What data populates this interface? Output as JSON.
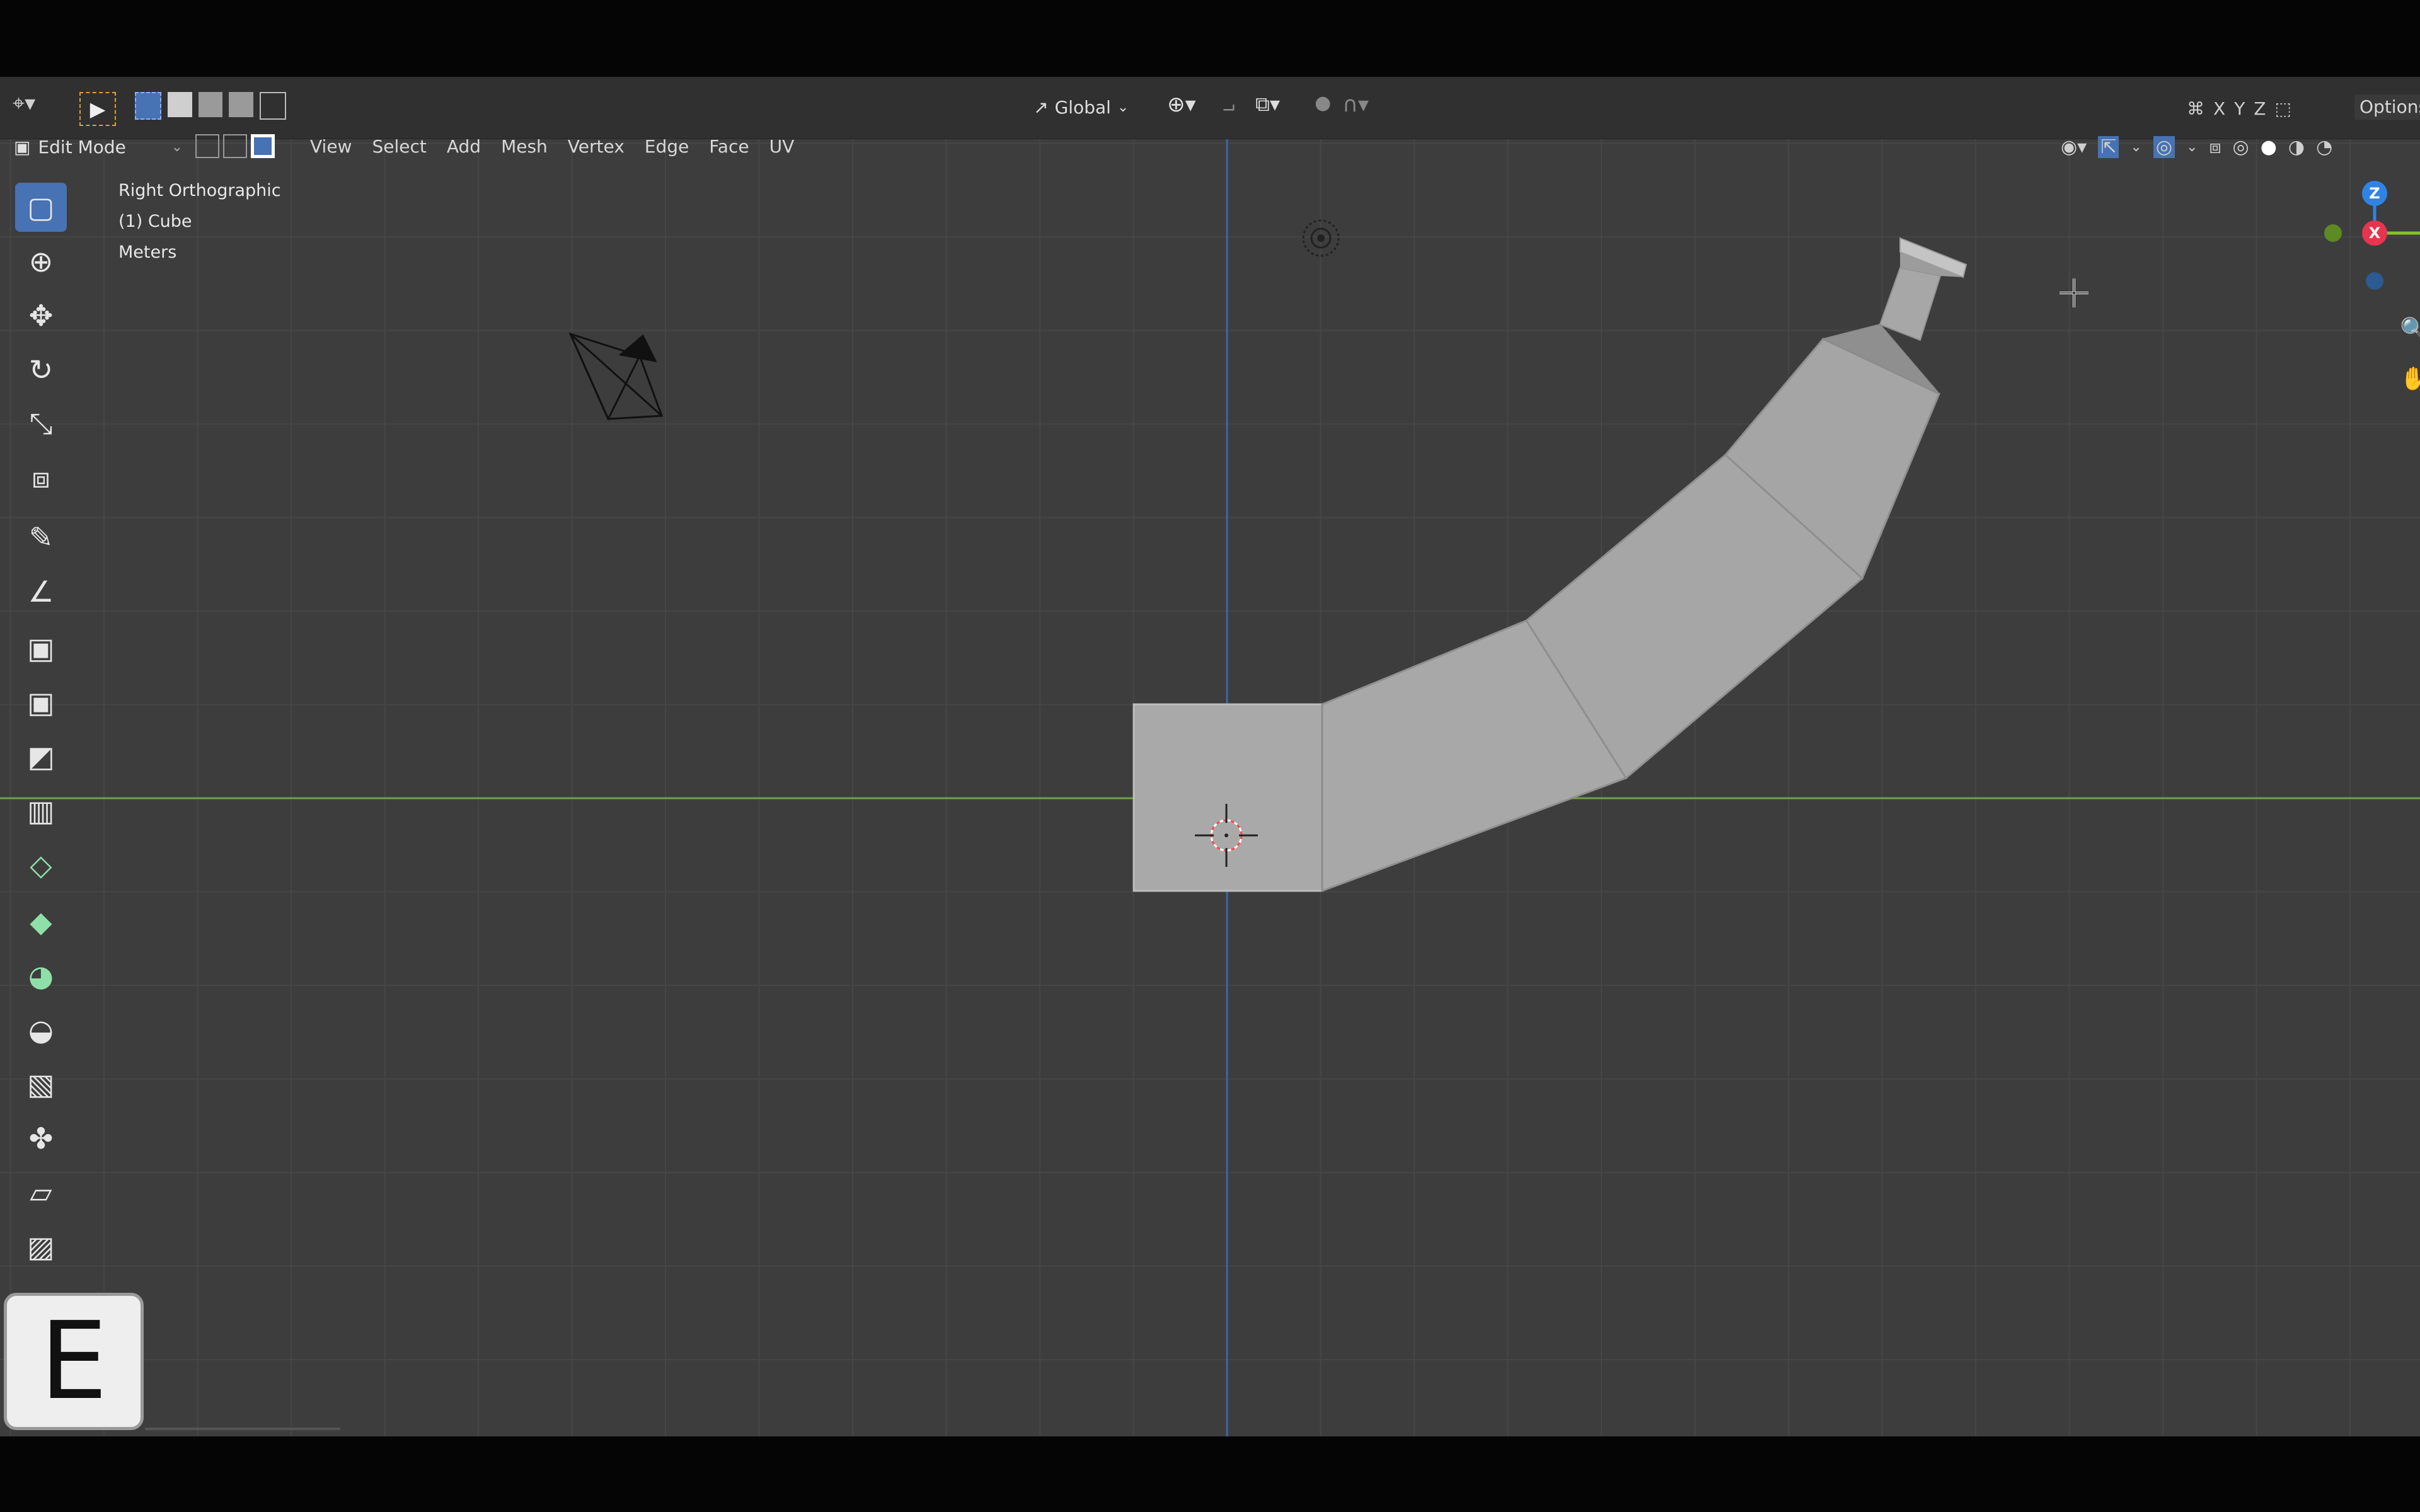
{
  "header": {
    "transform_orientation": "Global",
    "axis_x": "X",
    "axis_y": "Y",
    "axis_z": "Z",
    "options_label": "Options"
  },
  "mode_bar": {
    "mode": "Edit Mode",
    "menus": [
      "View",
      "Select",
      "Add",
      "Mesh",
      "Vertex",
      "Edge",
      "Face",
      "UV"
    ]
  },
  "viewport_info": {
    "view_name": "Right Orthographic",
    "object_name": "(1) Cube",
    "units": "Meters"
  },
  "gizmo": {
    "z_label": "Z",
    "x_label": "X",
    "colors": {
      "x": "#e8344e",
      "y": "#85c226",
      "z": "#2f84e3"
    }
  },
  "keycast": "E",
  "colors": {
    "viewport_bg": "#3d3d3d",
    "grid_line": "#464646",
    "y_axis_line": "#6fa04a",
    "z_axis_line": "#3a67a8",
    "mesh_face": "#a9a9a9",
    "active_tool": "#4772b3"
  },
  "toolbar_icons": [
    "select-box-icon",
    "cursor-icon",
    "move-icon",
    "rotate-icon",
    "scale-icon",
    "transform-icon",
    "annotate-icon",
    "measure-icon",
    "extrude-region-icon",
    "inset-faces-icon",
    "bevel-icon",
    "loop-cut-icon",
    "knife-icon",
    "poly-build-icon",
    "spin-icon",
    "smooth-icon",
    "edge-slide-icon",
    "shrink-fatten-icon",
    "shear-icon",
    "rip-region-icon"
  ]
}
